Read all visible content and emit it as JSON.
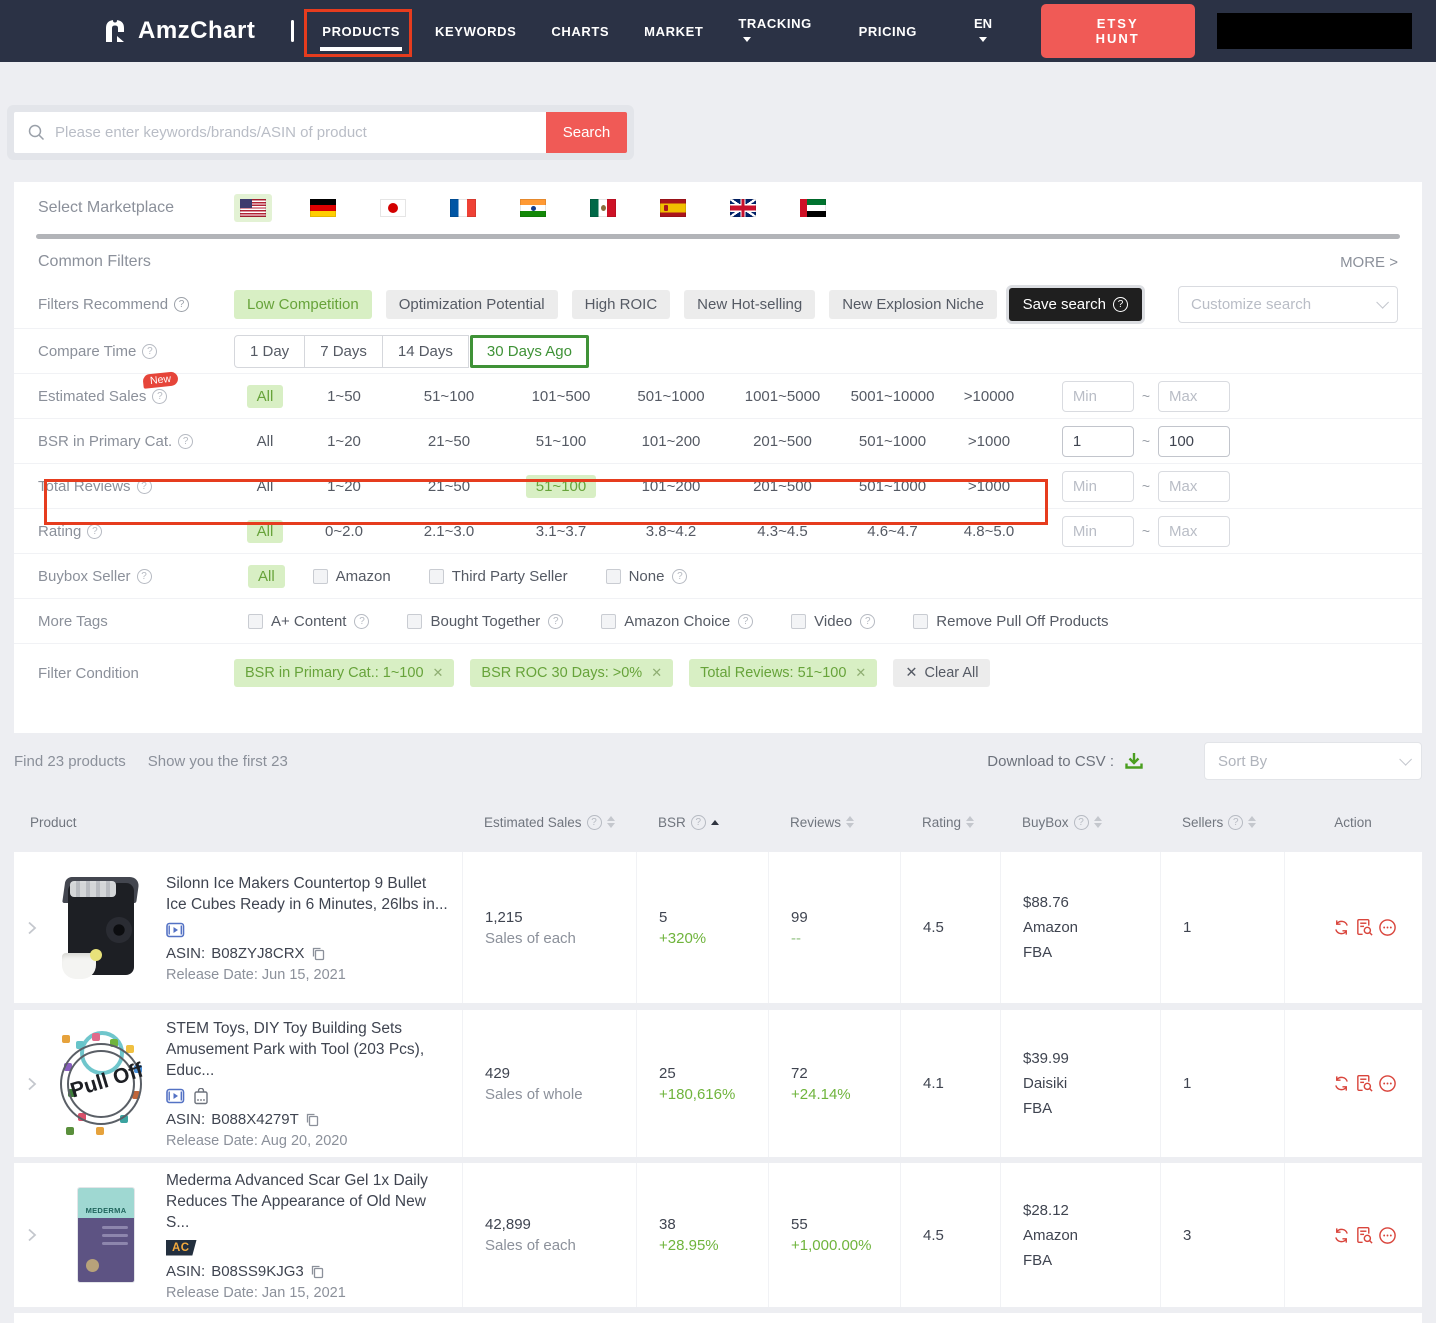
{
  "ui": {
    "range_separator": "~",
    "min_placeholder": "Min",
    "max_placeholder": "Max"
  },
  "nav": {
    "brand": "AmzChart",
    "items": [
      "PRODUCTS",
      "KEYWORDS",
      "CHARTS",
      "MARKET",
      "TRACKING",
      "PRICING"
    ],
    "language": "EN",
    "cta": "ETSY HUNT"
  },
  "search": {
    "placeholder": "Please enter keywords/brands/ASIN of product",
    "button": "Search"
  },
  "marketplace": {
    "label": "Select Marketplace",
    "flags": [
      "United States",
      "Germany",
      "Japan",
      "France",
      "India",
      "Mexico",
      "Spain",
      "United Kingdom",
      "United Arab Emirates"
    ],
    "selected": "United States"
  },
  "filters": {
    "section_title": "Common Filters",
    "more_link": "MORE >",
    "recommend": {
      "label": "Filters Recommend",
      "tags": [
        "Low Competition",
        "Optimization Potential",
        "High ROIC",
        "New Hot-selling",
        "New Explosion Niche"
      ],
      "active_tag": "Low Competition",
      "save_button": "Save search",
      "customize_placeholder": "Customize search"
    },
    "compare_time": {
      "label": "Compare Time",
      "options": [
        "1 Day",
        "7 Days",
        "14 Days",
        "30 Days Ago"
      ],
      "selected": "30 Days Ago"
    },
    "estimated_sales": {
      "label": "Estimated Sales",
      "badge": "New",
      "options": [
        "All",
        "1~50",
        "51~100",
        "101~500",
        "501~1000",
        "1001~5000",
        "5001~10000",
        ">10000"
      ],
      "selected": "All",
      "min_value": "",
      "max_value": ""
    },
    "bsr": {
      "label": "BSR in Primary Cat.",
      "options": [
        "All",
        "1~20",
        "21~50",
        "51~100",
        "101~200",
        "201~500",
        "501~1000",
        ">1000"
      ],
      "selected": "",
      "min_value": "1",
      "max_value": "100"
    },
    "total_reviews": {
      "label": "Total Reviews",
      "options": [
        "All",
        "1~20",
        "21~50",
        "51~100",
        "101~200",
        "201~500",
        "501~1000",
        ">1000"
      ],
      "selected": "51~100",
      "min_value": "",
      "max_value": ""
    },
    "rating": {
      "label": "Rating",
      "options": [
        "All",
        "0~2.0",
        "2.1~3.0",
        "3.1~3.7",
        "3.8~4.2",
        "4.3~4.5",
        "4.6~4.7",
        "4.8~5.0"
      ],
      "selected": "All",
      "min_value": "",
      "max_value": ""
    },
    "buybox": {
      "label": "Buybox Seller",
      "all_option": "All",
      "checkboxes": [
        "Amazon",
        "Third Party Seller",
        "None"
      ]
    },
    "more_tags": {
      "label": "More Tags",
      "checkboxes": [
        "A+ Content",
        "Bought Together",
        "Amazon Choice",
        "Video",
        "Remove Pull Off Products"
      ]
    },
    "condition": {
      "label": "Filter Condition",
      "tags": [
        "BSR in Primary Cat.: 1~100",
        "BSR ROC 30 Days: >0%",
        "Total Reviews: 51~100"
      ],
      "clear_all": "Clear All"
    }
  },
  "results": {
    "count_text": "Find 23 products",
    "show_text": "Show you the first 23",
    "download_label": "Download to CSV :",
    "sort_placeholder": "Sort By"
  },
  "table": {
    "headers": {
      "product": "Product",
      "estimated_sales": "Estimated Sales",
      "bsr": "BSR",
      "reviews": "Reviews",
      "rating": "Rating",
      "buybox": "BuyBox",
      "sellers": "Sellers",
      "action": "Action"
    },
    "rows": [
      {
        "title": "Silonn Ice Makers Countertop 9 Bullet Ice Cubes Ready in 6 Minutes, 26lbs in...",
        "asin_label": "ASIN:",
        "asin": "B08ZYJ8CRX",
        "release": "Release Date: Jun 15, 2021",
        "sales": "1,215",
        "sales_note": "Sales of each",
        "bsr": "5",
        "bsr_change": "+320%",
        "reviews": "99",
        "reviews_change": "--",
        "rating": "4.5",
        "price": "$88.76",
        "seller": "Amazon",
        "fulfillment": "FBA",
        "sellers": "1"
      },
      {
        "title": "STEM Toys, DIY Toy Building Sets Amusement Park with Tool (203 Pcs), Educ...",
        "asin_label": "ASIN:",
        "asin": "B088X4279T",
        "release": "Release Date: Aug 20, 2020",
        "sales": "429",
        "sales_note": "Sales of whole",
        "bsr": "25",
        "bsr_change": "+180,616%",
        "reviews": "72",
        "reviews_change": "+24.14%",
        "rating": "4.1",
        "price": "$39.99",
        "seller": "Daisiki",
        "fulfillment": "FBA",
        "sellers": "1",
        "stamp": "Pull Off"
      },
      {
        "title": "Mederma Advanced Scar Gel 1x Daily Reduces The Appearance of Old New S...",
        "asin_label": "ASIN:",
        "asin": "B08SS9KJG3",
        "release": "Release Date: Jan 15, 2021",
        "sales": "42,899",
        "sales_note": "Sales of each",
        "bsr": "38",
        "bsr_change": "+28.95%",
        "reviews": "55",
        "reviews_change": "+1,000.00%",
        "rating": "4.5",
        "price": "$28.12",
        "seller": "Amazon",
        "fulfillment": "FBA",
        "sellers": "3",
        "ac_badge": "AC",
        "brand_on_image": "MEDERMA"
      }
    ]
  }
}
